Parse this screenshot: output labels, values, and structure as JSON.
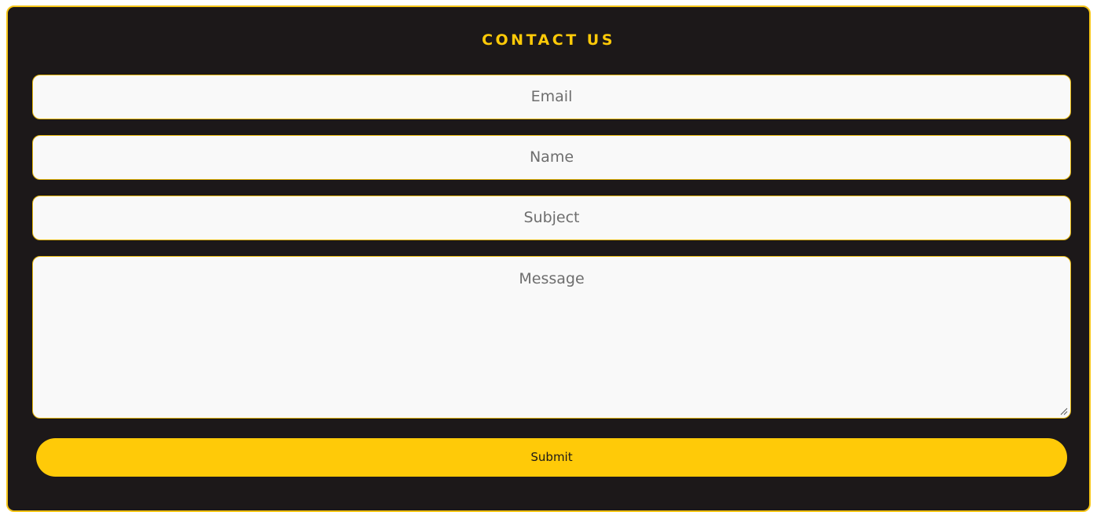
{
  "contact": {
    "title": "CONTACT US",
    "fields": {
      "email": {
        "placeholder": "Email"
      },
      "name": {
        "placeholder": "Name"
      },
      "subject": {
        "placeholder": "Subject"
      },
      "message": {
        "placeholder": "Message"
      }
    },
    "submit_label": "Submit"
  },
  "colors": {
    "background": "#1c1819",
    "accent": "#ffca08",
    "field_background": "#f9f9f9",
    "placeholder": "#6e6e6e"
  },
  "icons": {
    "textarea_resize": "resize-handle-icon"
  }
}
